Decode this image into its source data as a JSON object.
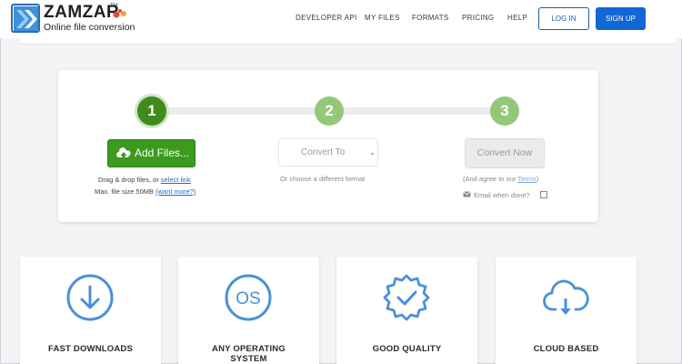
{
  "header": {
    "logo_word": "ZAMZAR",
    "logo_tm": "TM",
    "logo_tagline": "Online file conversion",
    "nav": [
      "DEVELOPER API",
      "MY FILES",
      "FORMATS",
      "PRICING",
      "HELP"
    ],
    "login_label": "LOG IN",
    "signup_label": "SIGN UP"
  },
  "converter": {
    "steps": [
      "1",
      "2",
      "3"
    ],
    "add_files_label": "Add Files...",
    "drag_text_prefix": "Drag & drop files, or ",
    "select_link": "select link",
    "max_size_prefix": "Max. file size 50MB ",
    "want_more_link": "(want more?)",
    "convert_to_value": "Convert To",
    "choose_format_text": "Or choose a different format",
    "convert_now_label": "Convert Now",
    "agree_prefix": "(And agree to our ",
    "terms_link": "Terms",
    "agree_suffix": ")",
    "email_label": "Email when done?"
  },
  "features": [
    {
      "title": "FAST DOWNLOADS",
      "icon": "download-circle-icon"
    },
    {
      "title_line1": "ANY OPERATING",
      "title_line2": "SYSTEM",
      "icon": "os-circle-icon"
    },
    {
      "title": "GOOD QUALITY",
      "icon": "quality-badge-icon"
    },
    {
      "title": "CLOUD BASED",
      "icon": "cloud-download-icon"
    }
  ],
  "colors": {
    "brand_blue": "#1266d6",
    "step_active": "#3f8b1c",
    "step_inactive": "#93c879",
    "add_button": "#3c9a1d",
    "icon_blue": "#4a90d9"
  }
}
